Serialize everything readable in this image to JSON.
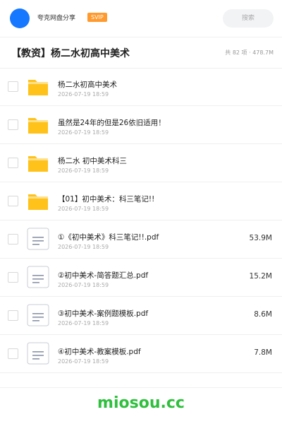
{
  "header": {
    "username": "夸克网盘分享",
    "vip_label": "SVIP",
    "search_placeholder": "搜索"
  },
  "folder": {
    "title": "【教资】杨二水初高中美术",
    "stats": "共 82 项 · 478.7M"
  },
  "items": [
    {
      "type": "folder",
      "name": "杨二水初高中美术",
      "date": "2026-07-19 18:59",
      "size": ""
    },
    {
      "type": "folder",
      "name": "虽然是24年的但是26依旧适用！",
      "date": "2026-07-19 18:59",
      "size": ""
    },
    {
      "type": "folder",
      "name": "杨二水 初中美术科三",
      "date": "2026-07-19 18:59",
      "size": ""
    },
    {
      "type": "folder",
      "name": "【01】初中美术：科三笔记!!",
      "date": "2026-07-19 18:59",
      "size": ""
    },
    {
      "type": "file",
      "name": "①《初中美术》科三笔记!!.pdf",
      "date": "2026-07-19 18:59",
      "size": "53.9M"
    },
    {
      "type": "file",
      "name": "②初中美术-简答题汇总.pdf",
      "date": "2026-07-19 18:59",
      "size": "15.2M"
    },
    {
      "type": "file",
      "name": "③初中美术-案例题模板.pdf",
      "date": "2026-07-19 18:59",
      "size": "8.6M"
    },
    {
      "type": "file",
      "name": "④初中美术-教案模板.pdf",
      "date": "2026-07-19 18:59",
      "size": "7.8M"
    }
  ],
  "footer": {
    "brand": "miosou.cc"
  },
  "colors": {
    "accent": "#1677ff",
    "vip": "#ff9a2e",
    "folder": "#ffc21a",
    "brand": "#2fbf3d"
  },
  "icons": {
    "folder": "folder-icon",
    "file": "document-icon"
  }
}
